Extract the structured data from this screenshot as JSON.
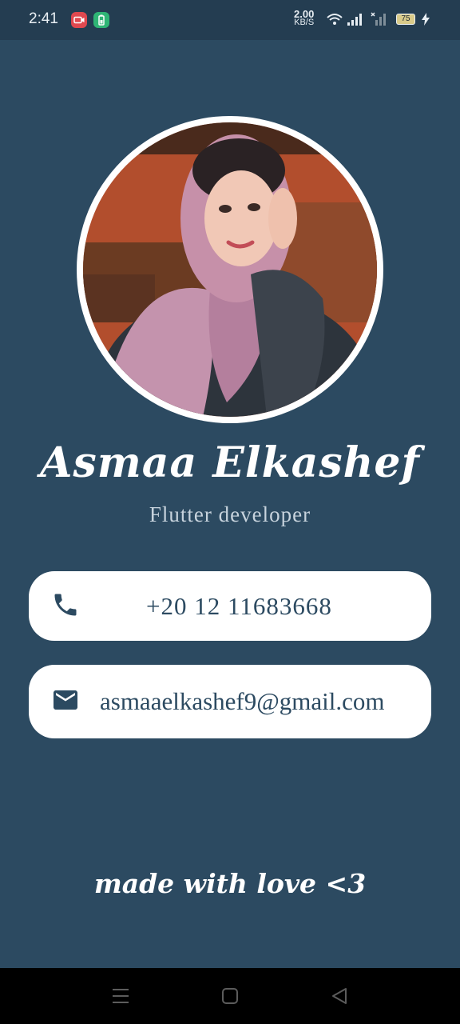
{
  "status_bar": {
    "time": "2:41",
    "net_speed_value": "2.00",
    "net_speed_unit": "KB/S",
    "battery_level": "75"
  },
  "profile": {
    "name": "Asmaa Elkashef",
    "title": "Flutter developer"
  },
  "contacts": {
    "phone": "+20 12 11683668",
    "email": "asmaaelkashef9@gmail.com"
  },
  "footer": {
    "text": "made with love <3"
  },
  "colors": {
    "background": "#2c4a61",
    "status_bar": "#243d51",
    "card": "#ffffff",
    "accent_text": "#2c4a61"
  },
  "icons": {
    "phone": "phone-icon",
    "email": "mail-icon",
    "nav_menu": "menu-icon",
    "nav_home": "home-square-icon",
    "nav_back": "back-triangle-icon"
  }
}
